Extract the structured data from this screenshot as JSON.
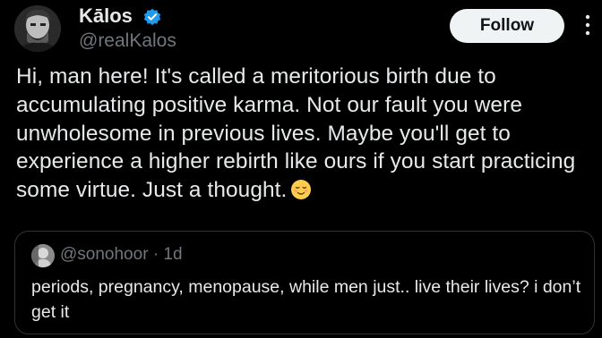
{
  "post": {
    "author": {
      "name": "Kālos",
      "handle": "@realKalos",
      "verified": true,
      "verified_color": "#1d9bf0"
    },
    "follow_label": "Follow",
    "text": "Hi, man here! It's called a meritorious birth due to accumulating positive karma. Not our fault you were unwholesome in previous lives. Maybe you'll get to experience a higher rebirth like ours if you start practicing some virtue. Just a thought.",
    "emoji": "relieved-face-icon"
  },
  "quote": {
    "handle": "@sonohoor",
    "separator": "·",
    "time": "1d",
    "text": "periods, pregnancy, menopause, while men just.. live their lives? i don’t get it"
  },
  "colors": {
    "background": "#000000",
    "text": "#e7e9ea",
    "secondary_text": "#71767b",
    "follow_bg": "#eff3f4",
    "border": "#2f3336"
  }
}
